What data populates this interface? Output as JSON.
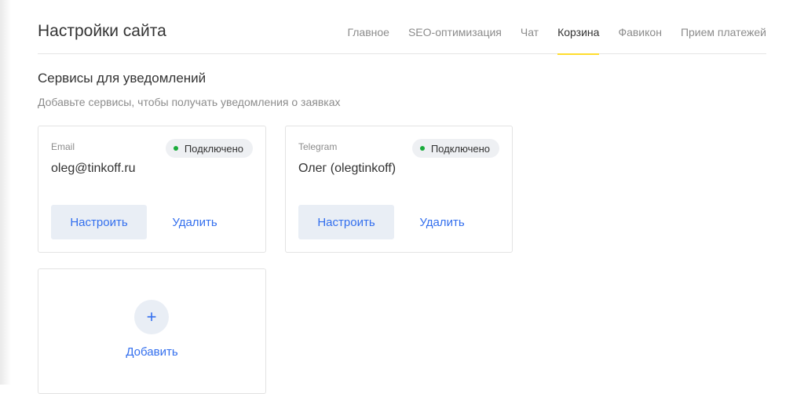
{
  "page": {
    "title": "Настройки сайта"
  },
  "tabs": [
    {
      "label": "Главное",
      "active": false
    },
    {
      "label": "SEO-оптимизация",
      "active": false
    },
    {
      "label": "Чат",
      "active": false
    },
    {
      "label": "Корзина",
      "active": true
    },
    {
      "label": "Фавикон",
      "active": false
    },
    {
      "label": "Прием платежей",
      "active": false
    }
  ],
  "section": {
    "title": "Сервисы для уведомлений",
    "subtitle": "Добавьте сервисы, чтобы получать уведомления о заявках"
  },
  "services": [
    {
      "label": "Email",
      "value": "oleg@tinkoff.ru",
      "status": "Подключено",
      "configure_label": "Настроить",
      "delete_label": "Удалить"
    },
    {
      "label": "Telegram",
      "value": "Олег (olegtinkoff)",
      "status": "Подключено",
      "configure_label": "Настроить",
      "delete_label": "Удалить"
    }
  ],
  "add_card": {
    "icon": "plus-icon",
    "label": "Добавить"
  },
  "colors": {
    "accent": "#336fee",
    "active_tab_underline": "#ffdd2d",
    "status_connected": "#1aab3b"
  }
}
